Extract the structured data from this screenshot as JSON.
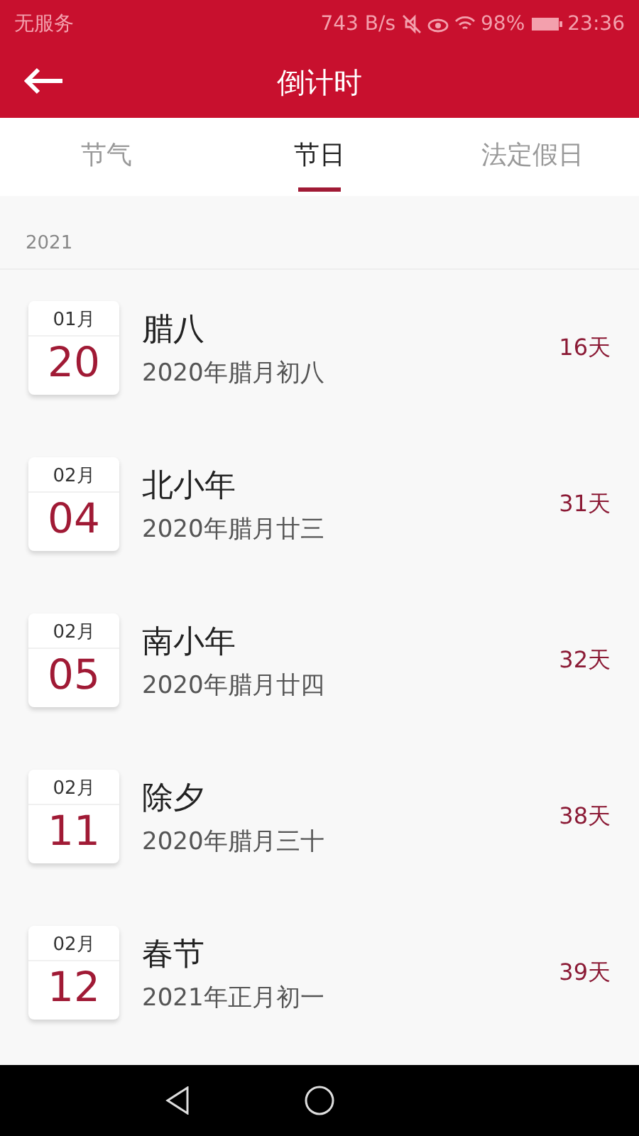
{
  "status_bar": {
    "carrier": "无服务",
    "speed": "743 B/s",
    "battery": "98%",
    "time": "23:36"
  },
  "header": {
    "title": "倒计时"
  },
  "tabs": [
    {
      "label": "节气",
      "selected": false
    },
    {
      "label": "节日",
      "selected": true
    },
    {
      "label": "法定假日",
      "selected": false
    }
  ],
  "section": {
    "year": "2021"
  },
  "events": [
    {
      "month": "01月",
      "day": "20",
      "name": "腊八",
      "lunar": "2020年腊月初八",
      "countdown": "16天"
    },
    {
      "month": "02月",
      "day": "04",
      "name": "北小年",
      "lunar": "2020年腊月廿三",
      "countdown": "31天"
    },
    {
      "month": "02月",
      "day": "05",
      "name": "南小年",
      "lunar": "2020年腊月廿四",
      "countdown": "32天"
    },
    {
      "month": "02月",
      "day": "11",
      "name": "除夕",
      "lunar": "2020年腊月三十",
      "countdown": "38天"
    },
    {
      "month": "02月",
      "day": "12",
      "name": "春节",
      "lunar": "2021年正月初一",
      "countdown": "39天"
    }
  ]
}
